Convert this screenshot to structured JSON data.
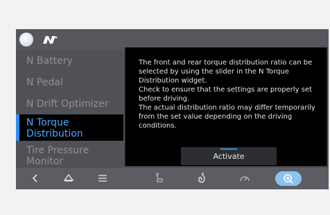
{
  "menu": {
    "items": [
      {
        "label": "N Battery"
      },
      {
        "label": "N Pedal"
      },
      {
        "label": "N Drift Optimizer"
      },
      {
        "label": "N Torque Distribution",
        "line1": "N Torque",
        "line2": "Distribution",
        "selected": true
      },
      {
        "label": "Tire Pressure Monitor",
        "line1": "Tire Pressure",
        "line2": "Monitor"
      }
    ]
  },
  "dialog": {
    "paragraph1": "The front and rear torque distribution ratio can be selected by using the slider in the N Torque Distribution widget.",
    "paragraph2": "Check to ensure that the settings are properly set before driving.",
    "paragraph3": "The actual distribution ratio may differ temporarily from the set value depending on the driving conditions.",
    "activate_label": "Activate"
  },
  "icons": {
    "brand": "n-logo-icon",
    "profile": "profile-avatar-icon",
    "back": "back-chevron-icon",
    "home": "home-icon",
    "menu": "menu-lines-icon",
    "seat": "seat-icon",
    "climate": "climate-icon",
    "drive_mode": "gauge-icon",
    "n_mode": "n-mode-icon"
  },
  "colors": {
    "selected_text": "#4aa8ff",
    "accent": "#2f8ff0",
    "active_pill": "#8cc3ee"
  }
}
